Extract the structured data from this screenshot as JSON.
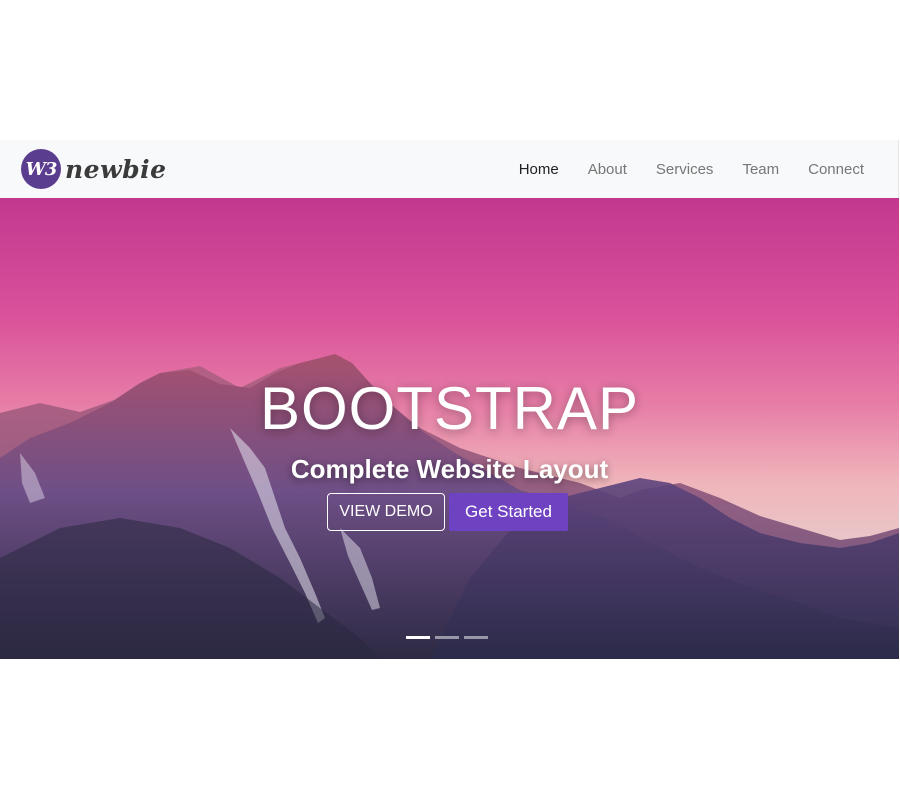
{
  "brand": {
    "badge": "W3",
    "name": "newbie",
    "badge_color": "#5b3d8f"
  },
  "nav": {
    "items": [
      {
        "label": "Home",
        "active": true
      },
      {
        "label": "About",
        "active": false
      },
      {
        "label": "Services",
        "active": false
      },
      {
        "label": "Team",
        "active": false
      },
      {
        "label": "Connect",
        "active": false
      }
    ]
  },
  "hero": {
    "title": "BOOTSTRAP",
    "subtitle": "Complete Website Layout",
    "buttons": {
      "demo": "VIEW DEMO",
      "start": "Get Started"
    },
    "accent_color": "#6f42c1",
    "carousel": {
      "slides": 3,
      "active_slide": 1
    }
  }
}
